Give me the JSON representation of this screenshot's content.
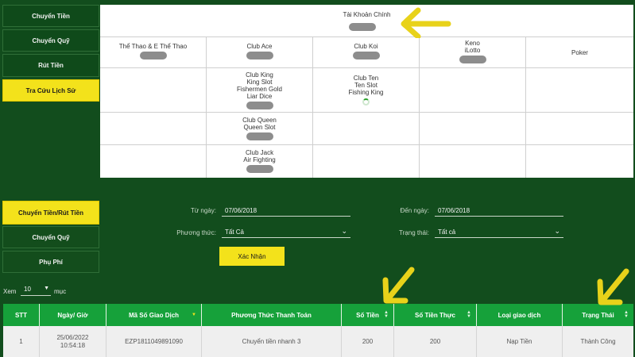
{
  "top_menu": [
    "Chuyển Tiền",
    "Chuyển Quỹ",
    "Rút Tiền",
    "Tra Cứu Lịch Sử"
  ],
  "balance": {
    "main_label": "Tài Khoản Chính",
    "cells": [
      "Thể Thao & E Thể Thao",
      "Club Ace",
      "Club Koi",
      "Keno\niLotto",
      "Poker",
      "Club King\nKing Slot\nFishermen Gold\nLiar Dice",
      "Club Ten\nTen Slot\nFishing King",
      "Club Queen\nQueen Slot",
      "Club Jack\nAir Fighting"
    ]
  },
  "bottom_menu": [
    "Chuyển Tiền/Rút Tiền",
    "Chuyển Quỹ",
    "Phụ Phí"
  ],
  "filters": {
    "from_label": "Từ ngày:",
    "from_value": "07/06/2018",
    "to_label": "Đến ngày:",
    "to_value": "07/06/2018",
    "method_label": "Phương thức:",
    "method_value": "Tất Cả",
    "status_label": "Trạng thái:",
    "status_value": "Tất cả",
    "confirm": "Xác Nhận"
  },
  "page_size": {
    "prefix": "Xem",
    "value": "10",
    "suffix": "mục"
  },
  "table": {
    "headers": [
      "STT",
      "Ngày/ Giờ",
      "Mã Số Giao Dịch",
      "Phương Thức Thanh Toán",
      "Số Tiền",
      "Số Tiền Thực",
      "Loại giao dịch",
      "Trạng Thái"
    ],
    "rows": [
      [
        "1",
        "25/06/2022\n10:54:18",
        "EZP1811049891090",
        "Chuyển tiền nhanh 3",
        "200",
        "200",
        "Nạp Tiền",
        "Thành Công"
      ]
    ]
  },
  "colors": {
    "background": "#124d1d",
    "accent_yellow": "#f3e21b",
    "header_green": "#16a13a",
    "arrow": "#e8d21a"
  }
}
